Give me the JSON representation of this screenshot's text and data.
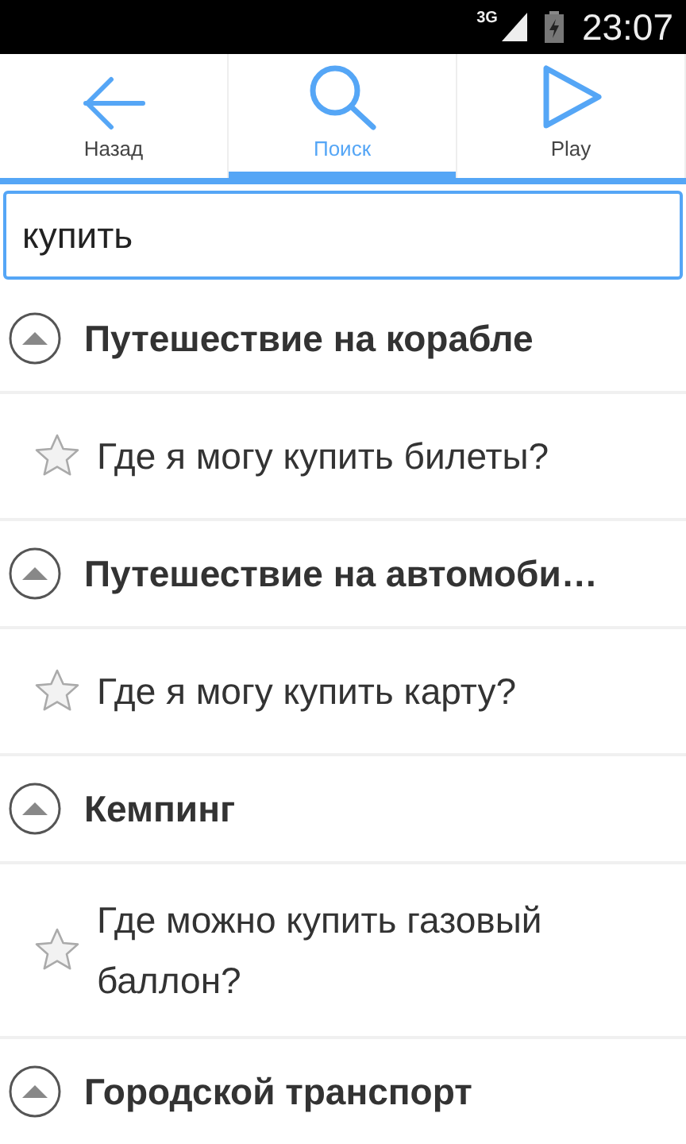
{
  "status_bar": {
    "network": "3G",
    "time": "23:07"
  },
  "tabs": [
    {
      "label": "Назад",
      "kind": "back",
      "selected": false
    },
    {
      "label": "Поиск",
      "kind": "search",
      "selected": true
    },
    {
      "label": "Play",
      "kind": "play",
      "selected": false
    }
  ],
  "search": {
    "value": "купить"
  },
  "groups": [
    {
      "title": "Путешествие на корабле",
      "expanded": true,
      "children": [
        {
          "text": "Где я могу купить билеты?",
          "starred": false
        }
      ]
    },
    {
      "title": "Путешествие на автомоби…",
      "expanded": true,
      "children": [
        {
          "text": "Где я могу купить карту?",
          "starred": false
        }
      ]
    },
    {
      "title": "Кемпинг",
      "expanded": true,
      "children": [
        {
          "text": "Где можно купить газовый баллон?",
          "starred": false
        }
      ]
    },
    {
      "title": "Городской транспорт",
      "expanded": true
    }
  ]
}
